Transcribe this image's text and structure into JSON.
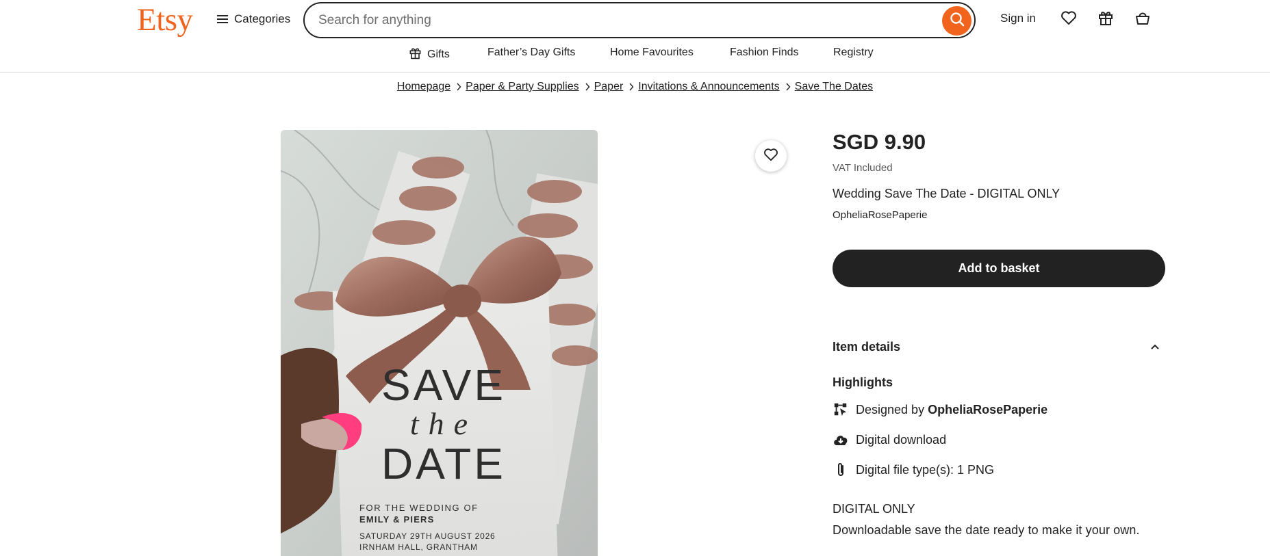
{
  "header": {
    "logo": "Etsy",
    "categories_label": "Categories",
    "search_placeholder": "Search for anything",
    "signin_label": "Sign in",
    "brand_color": "#f1641e"
  },
  "nav": {
    "items": [
      "Gifts",
      "Father’s Day Gifts",
      "Home Favourites",
      "Fashion Finds",
      "Registry"
    ]
  },
  "breadcrumb": [
    "Homepage",
    "Paper & Party Supplies",
    "Paper",
    "Invitations & Announcements",
    "Save The Dates"
  ],
  "product": {
    "price": "SGD 9.90",
    "vat": "VAT Included",
    "title": "Wedding Save The Date - DIGITAL ONLY",
    "shop": "OpheliaRosePaperie",
    "add_to_basket": "Add to basket",
    "image_text": {
      "save": "SAVE",
      "the": "the",
      "date": "DATE",
      "for_wedding": "FOR THE WEDDING OF",
      "names": "EMILY & PIERS",
      "date_line": "SATURDAY 29TH AUGUST 2026",
      "venue": "IRNHAM HALL, GRANTHAM"
    }
  },
  "details": {
    "heading": "Item details",
    "highlights_label": "Highlights",
    "designed_prefix": "Designed by",
    "designer": "OpheliaRosePaperie",
    "download": "Digital download",
    "file_types": "Digital file type(s): 1 PNG",
    "desc_title": "DIGITAL ONLY",
    "desc_body": "Downloadable save the date ready to make it your own."
  }
}
